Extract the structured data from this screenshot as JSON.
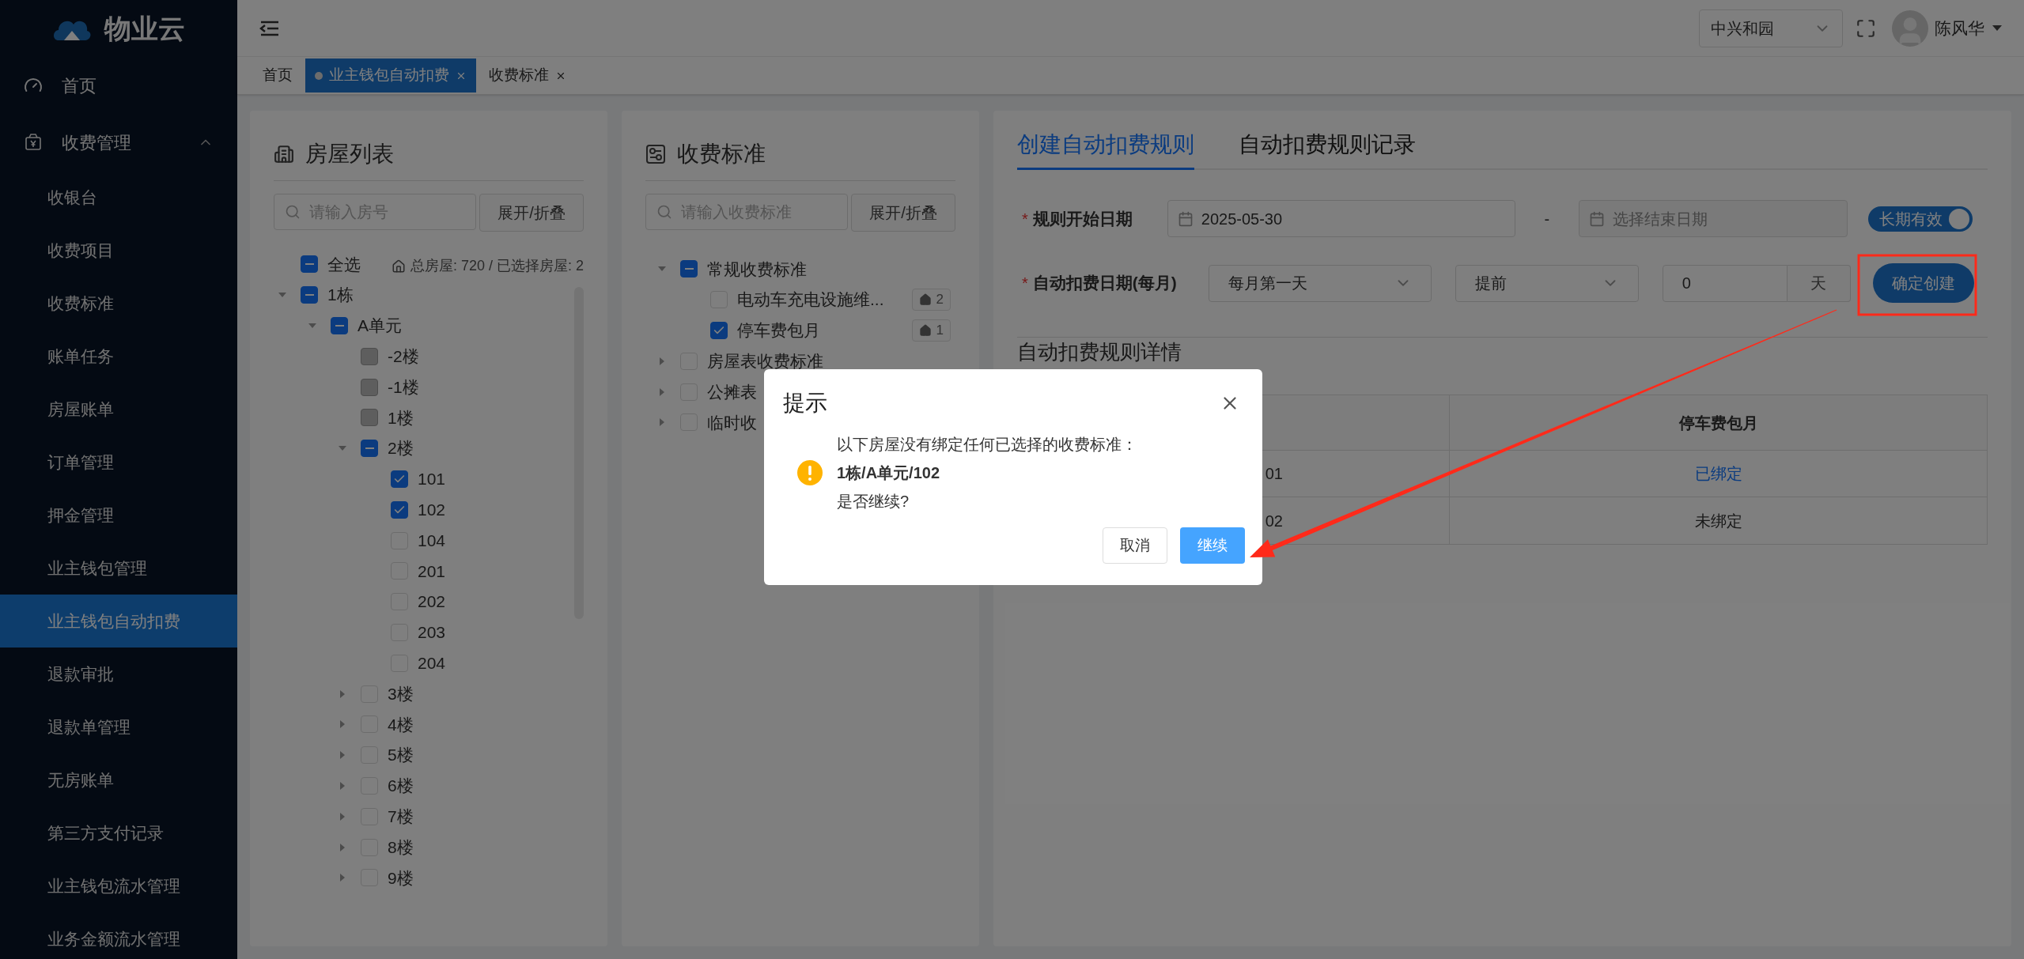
{
  "sidebar": {
    "logo": "物业云",
    "menu": [
      {
        "label": "首页",
        "kind": "item"
      },
      {
        "label": "收费管理",
        "kind": "group",
        "expanded": true,
        "children": [
          {
            "label": "收银台",
            "selected": false
          },
          {
            "label": "收费项目",
            "selected": false
          },
          {
            "label": "收费标准",
            "selected": false
          },
          {
            "label": "账单任务",
            "selected": false
          },
          {
            "label": "房屋账单",
            "selected": false
          },
          {
            "label": "订单管理",
            "selected": false
          },
          {
            "label": "押金管理",
            "selected": false
          },
          {
            "label": "业主钱包管理",
            "selected": false
          },
          {
            "label": "业主钱包自动扣费",
            "selected": true
          },
          {
            "label": "退款审批",
            "selected": false
          },
          {
            "label": "退款单管理",
            "selected": false
          },
          {
            "label": "无房账单",
            "selected": false
          },
          {
            "label": "第三方支付记录",
            "selected": false
          },
          {
            "label": "业主钱包流水管理",
            "selected": false
          },
          {
            "label": "业务金额流水管理",
            "selected": false
          }
        ]
      }
    ]
  },
  "header": {
    "community": "中兴和园",
    "user": "陈风华"
  },
  "tabs": [
    {
      "label": "首页",
      "selected": false,
      "closable": false
    },
    {
      "label": "业主钱包自动扣费",
      "selected": true,
      "closable": true
    },
    {
      "label": "收费标准",
      "selected": false,
      "closable": true
    }
  ],
  "house_panel": {
    "title": "房屋列表",
    "search": {
      "placeholder": "请输入房号"
    },
    "toggle_button": "展开/折叠",
    "summary": "总房屋: 720 / 已选择房屋: 2",
    "tree": [
      {
        "label": "全选",
        "checked": true,
        "partial": true
      },
      {
        "label": "1栋",
        "checked": true,
        "partial": true,
        "expanded": true,
        "children": [
          {
            "label": "A单元",
            "checked": true,
            "partial": true,
            "expanded": true,
            "children": [
              {
                "label": "-2楼",
                "checked": false,
                "disabled": true
              },
              {
                "label": "-1楼",
                "checked": false,
                "disabled": true
              },
              {
                "label": "1楼",
                "checked": false,
                "disabled": true
              },
              {
                "label": "2楼",
                "checked": true,
                "partial": true,
                "disabled": false,
                "expanded": true,
                "children": [
                  {
                    "label": "101",
                    "checked": true
                  },
                  {
                    "label": "102",
                    "checked": true
                  },
                  {
                    "label": "104",
                    "checked": false
                  },
                  {
                    "label": "201",
                    "checked": false
                  },
                  {
                    "label": "202",
                    "checked": false
                  },
                  {
                    "label": "203",
                    "checked": false
                  },
                  {
                    "label": "204",
                    "checked": false
                  }
                ]
              },
              {
                "label": "3楼",
                "checked": false,
                "disabled": false,
                "expanded": false
              },
              {
                "label": "4楼",
                "checked": false,
                "disabled": false,
                "expanded": false
              },
              {
                "label": "5楼",
                "checked": false,
                "disabled": false,
                "expanded": false
              },
              {
                "label": "6楼",
                "checked": false,
                "disabled": false,
                "expanded": false
              },
              {
                "label": "7楼",
                "checked": false,
                "disabled": false,
                "expanded": false
              },
              {
                "label": "8楼",
                "checked": false,
                "disabled": false,
                "expanded": false
              },
              {
                "label": "9楼",
                "checked": false,
                "disabled": false,
                "expanded": false
              }
            ]
          }
        ]
      }
    ]
  },
  "standard_panel": {
    "title": "收费标准",
    "search": {
      "placeholder": "请输入收费标准"
    },
    "toggle_button": "展开/折叠",
    "tree": [
      {
        "label": "常规收费标准",
        "checked": true,
        "partial": true,
        "expanded": true,
        "children": [
          {
            "label": "电动车充电设施维...",
            "checked": false,
            "count": "2"
          },
          {
            "label": "停车费包月",
            "checked": true,
            "count": "1"
          }
        ]
      },
      {
        "label": "房屋表收费标准",
        "checked": false,
        "expanded": false
      },
      {
        "label": "公摊表",
        "checked": false,
        "expanded": false
      },
      {
        "label": "临时收",
        "checked": false,
        "expanded": false
      }
    ]
  },
  "rule_panel": {
    "tabs": [
      {
        "label": "创建自动扣费规则",
        "selected": true
      },
      {
        "label": "自动扣费规则记录",
        "selected": false
      }
    ],
    "start_required": "*",
    "start_label": "规则开始日期",
    "start_date": "2025-05-30",
    "range_separator": "-",
    "end_placeholder": "选择结束日期",
    "long_term": {
      "label": "长期有效",
      "on": true
    },
    "day_required": "*",
    "day_label": "自动扣费日期(每月)",
    "day_select": "每月第一天",
    "offset_select": "提前",
    "offset_value": "0",
    "offset_unit": "天",
    "create_button": "确定创建",
    "details_title": "自动扣费规则详情",
    "table": {
      "columns": [
        "停车费包月"
      ],
      "rows": [
        {
          "cell_1": "01",
          "status": "已绑定",
          "bound": true
        },
        {
          "cell_1": "02",
          "status": "未绑定",
          "bound": false
        }
      ]
    }
  },
  "dialog": {
    "title": "提示",
    "message": "以下房屋没有绑定任何已选择的收费标准：",
    "houses": "1栋/A单元/102",
    "question": "是否继续?",
    "cancel": "取消",
    "confirm": "继续"
  },
  "annotations": {
    "highlight_box": true,
    "arrow": true
  }
}
